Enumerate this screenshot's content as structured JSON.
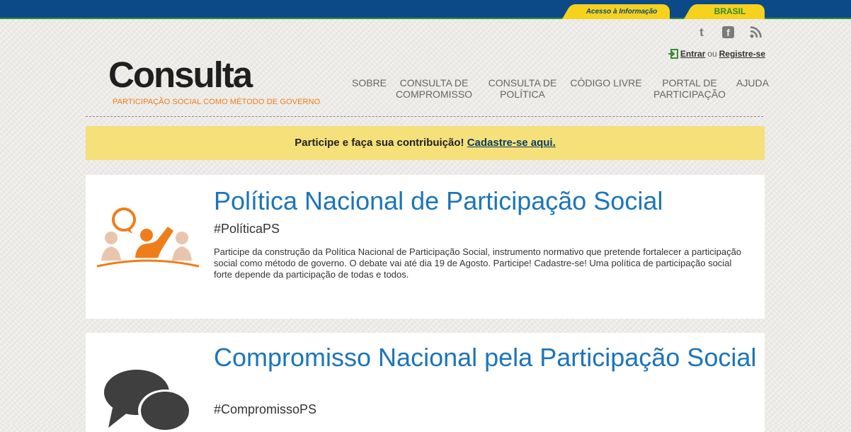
{
  "govbar": {
    "acesso": "Acesso à Informação",
    "brasil": "BRASIL"
  },
  "social": {
    "twitter": "twitter-icon",
    "facebook": "facebook-icon",
    "rss": "rss-icon"
  },
  "auth": {
    "login": "Entrar",
    "or": "ou",
    "register": "Registre-se"
  },
  "logo": {
    "title": "Consulta",
    "tagline": "PARTICIPAÇÃO SOCIAL COMO MÉTODO DE GOVERNO"
  },
  "nav": [
    {
      "label": "SOBRE"
    },
    {
      "label": "CONSULTA DE COMPROMISSO"
    },
    {
      "label": "CONSULTA DE POLÍTICA"
    },
    {
      "label": "CÓDIGO LIVRE"
    },
    {
      "label": "PORTAL DE PARTICIPAÇÃO"
    },
    {
      "label": "AJUDA"
    }
  ],
  "banner": {
    "text": "Participe e faça sua contribuição!",
    "link": "Cadastre-se aqui."
  },
  "cards": [
    {
      "title": "Política Nacional de Participação Social",
      "hashtag": "#PolíticaPS",
      "description": "Participe da construção da Política Nacional de Participação Social, instrumento normativo que pretende fortalecer a participação social como método de governo. O debate vai até dia 19 de Agosto. Participe! Cadastre-se! Uma política de participação social  forte depende da participação de todas e todos.",
      "icon": "participation-people-icon"
    },
    {
      "title": "Compromisso Nacional pela Participação Social",
      "hashtag": "#CompromissoPS",
      "icon": "speech-bubbles-icon"
    }
  ],
  "colors": {
    "govbar": "#0b4a86",
    "accent": "#ef7d1a",
    "link": "#1c75b9",
    "banner": "#f5e07a"
  }
}
